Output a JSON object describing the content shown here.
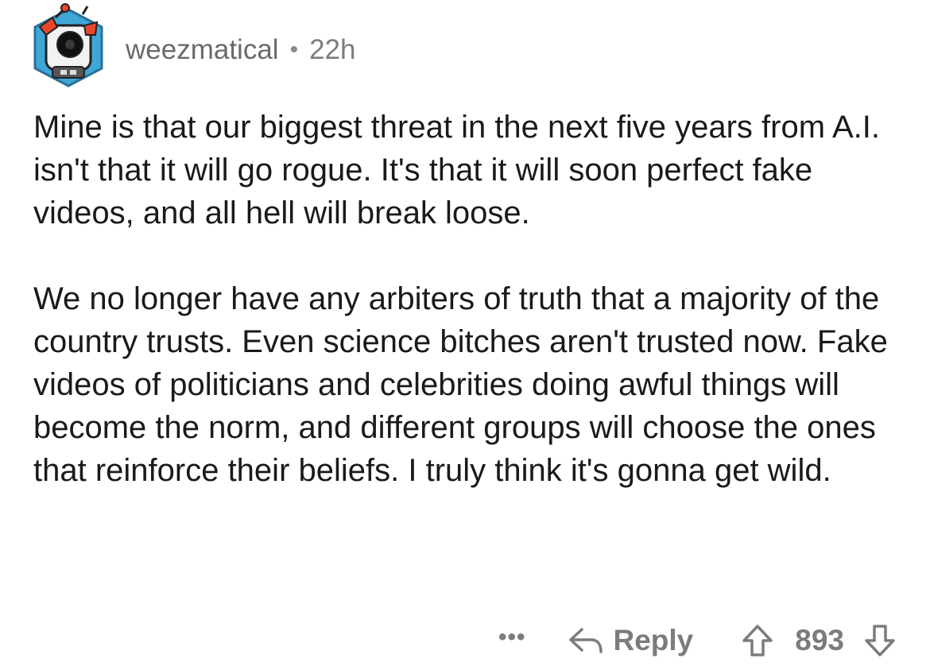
{
  "comment": {
    "author": "weezmatical",
    "separator": "•",
    "age": "22h",
    "paragraphs": [
      "Mine is that our biggest threat in the next five years from A.I. isn't that it will go rogue. It's that it will soon perfect fake videos, and all hell will break loose.",
      "We no longer have any arbiters of truth that a majority of the country trusts. Even science bitches aren't trusted now. Fake videos of politicians and celebrities doing awful things will become the norm, and different groups will choose the ones that reinforce their beliefs. I truly think it's gonna get wild."
    ]
  },
  "actions": {
    "more": "•••",
    "reply_label": "Reply",
    "score": "893"
  },
  "icons": {
    "avatar": "snoo-robot-avatar-icon",
    "reply": "reply-arrow-icon",
    "upvote": "upvote-arrow-icon",
    "downvote": "downvote-arrow-icon",
    "more": "more-options-icon"
  },
  "colors": {
    "text": "#1a1a1b",
    "meta": "#7c7c7c",
    "background": "#ffffff"
  }
}
